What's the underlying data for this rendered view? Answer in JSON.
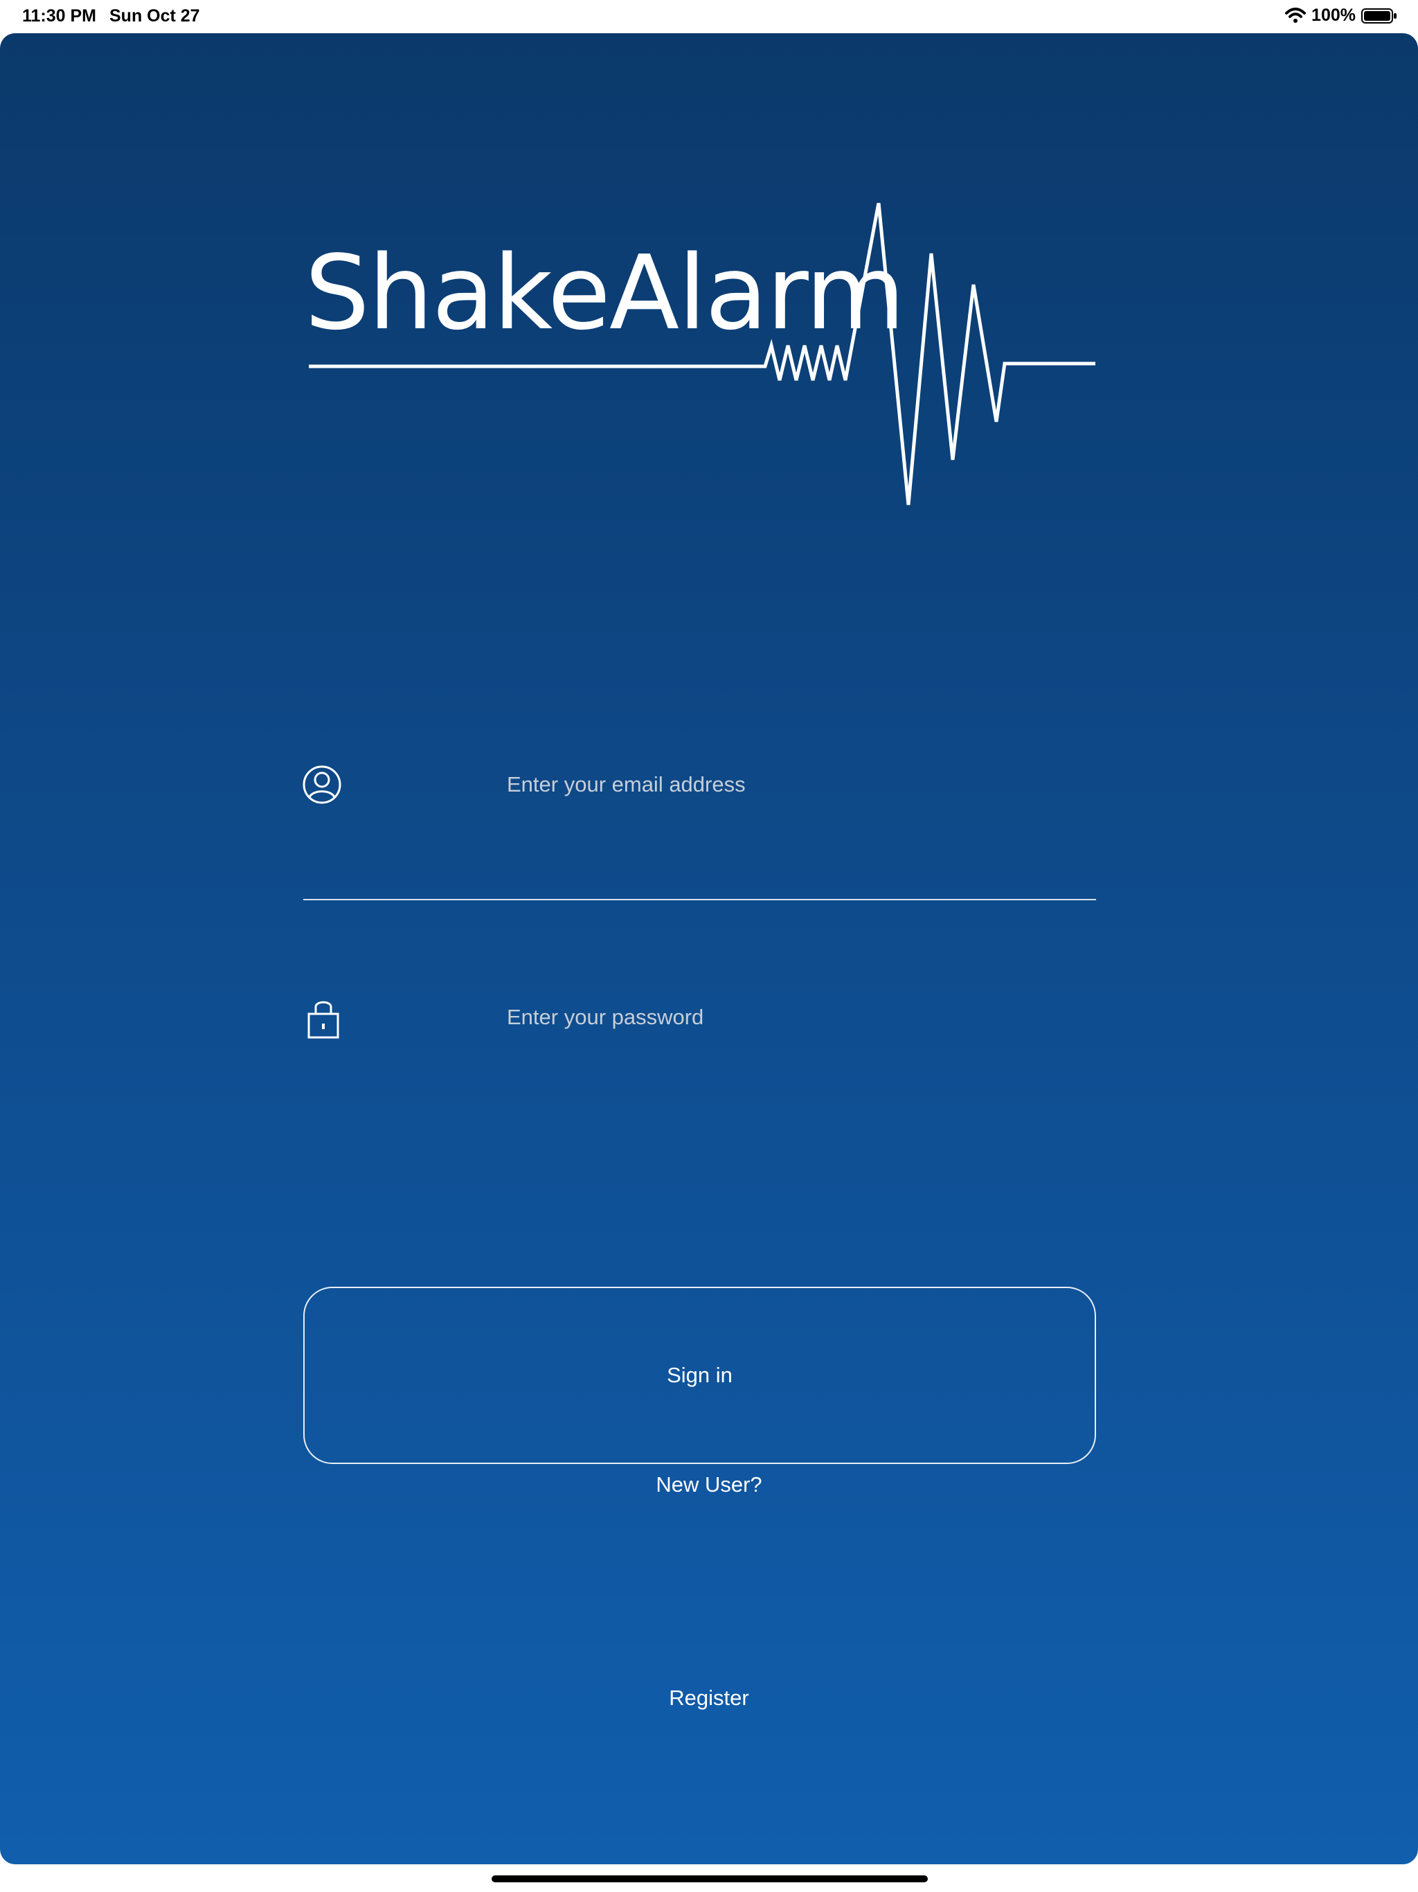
{
  "status_bar": {
    "time": "11:30 PM",
    "date": "Sun Oct 27",
    "battery_percent": "100%",
    "icons": [
      "wifi-icon",
      "battery-icon"
    ]
  },
  "app": {
    "logo_text": "ShakeAlarm",
    "email_placeholder": "Enter your email address",
    "password_placeholder": "Enter your password",
    "sign_in_label": "Sign in",
    "new_user_label": "New User?",
    "register_label": "Register",
    "icons": [
      "user-circle-icon",
      "lock-icon",
      "seismograph-logo-icon"
    ]
  },
  "colors": {
    "gradient_top": "#0b396b",
    "gradient_bottom": "#115ead",
    "text": "#ffffff",
    "placeholder": "#c7cfd9"
  }
}
